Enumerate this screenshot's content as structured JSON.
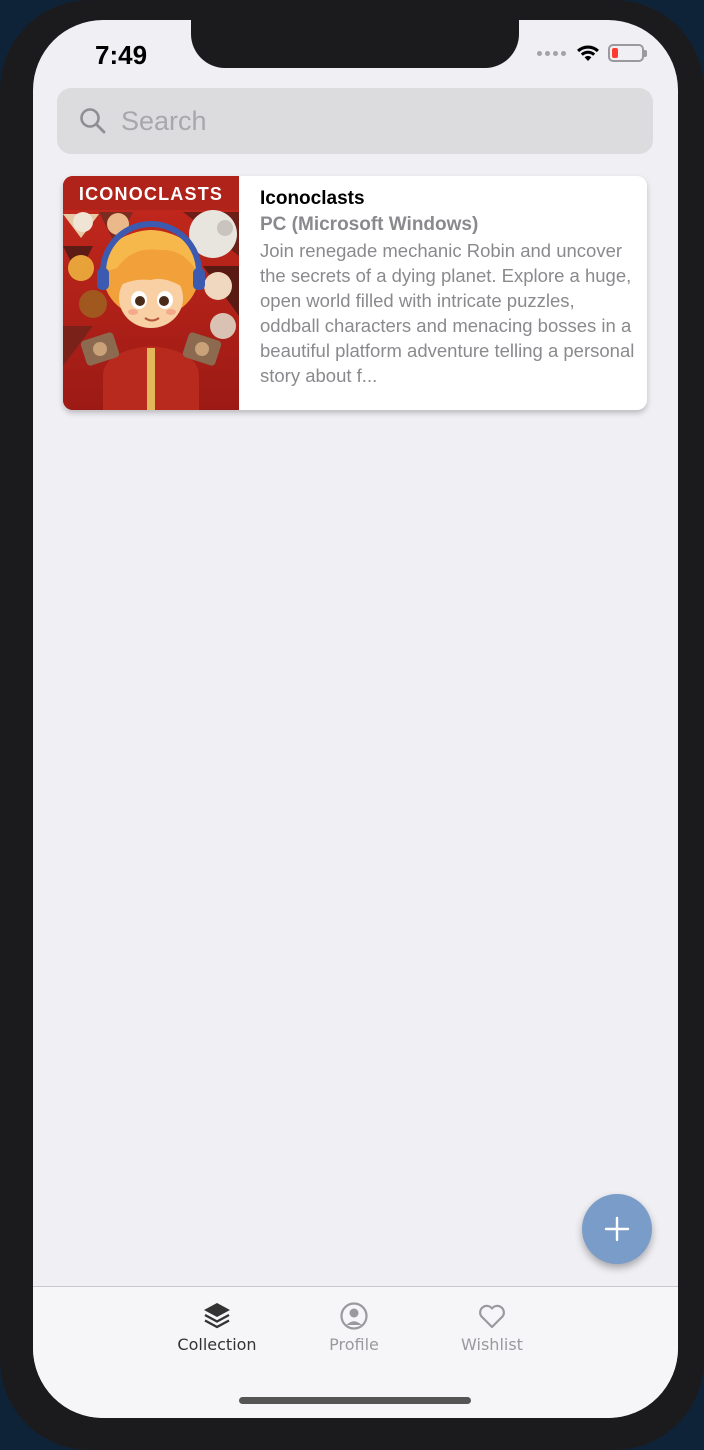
{
  "status_bar": {
    "time": "7:49"
  },
  "search": {
    "placeholder": "Search",
    "value": ""
  },
  "games": [
    {
      "cover_title": "ICONOCLASTS",
      "title": "Iconoclasts",
      "platform": "PC (Microsoft Windows)",
      "description": "Join renegade mechanic Robin and uncover the secrets of a dying planet. Explore a huge, open world filled with intricate puzzles, oddball characters and menacing bosses in a beautiful platform adventure telling a personal story about f..."
    }
  ],
  "fab": {
    "icon": "plus-icon",
    "color": "#7a9cc9"
  },
  "tabs": [
    {
      "label": "Collection",
      "icon": "layers-icon",
      "active": true
    },
    {
      "label": "Profile",
      "icon": "user-circle-icon",
      "active": false
    },
    {
      "label": "Wishlist",
      "icon": "heart-icon",
      "active": false
    }
  ],
  "colors": {
    "background": "#efeff4",
    "battery_low": "#ff3b30",
    "active_tab": "#333333",
    "inactive_tab": "#9a9a9e"
  }
}
